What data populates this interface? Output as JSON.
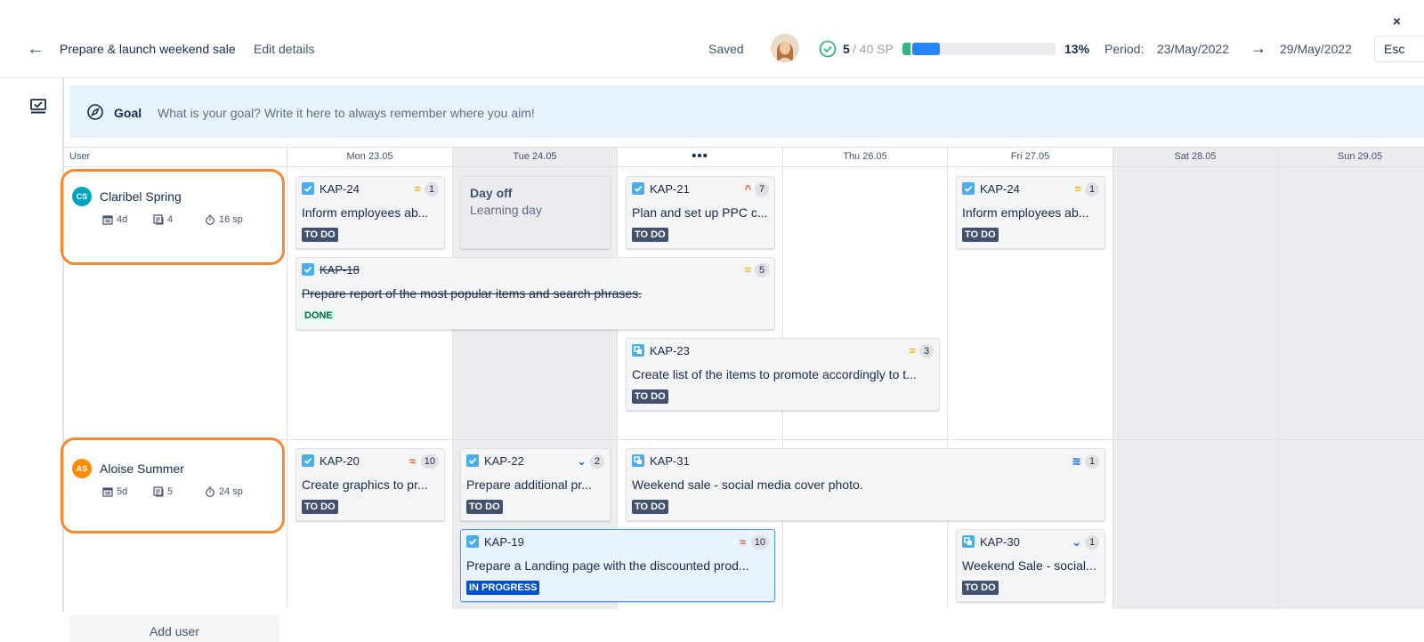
{
  "header": {
    "close_label": "×",
    "title": "Prepare & launch weekend sale",
    "edit_details": "Edit details",
    "saved": "Saved",
    "sp_done": "5",
    "sp_total": "/ 40 SP",
    "progress": {
      "done_fraction": 0.05,
      "inprogress_fraction": 0.08
    },
    "percent": "13%",
    "period_label": "Period:",
    "period_start": "23/May/2022",
    "period_end": "29/May/2022",
    "esc_label": "Esc"
  },
  "goal": {
    "label": "Goal",
    "placeholder": "What is your goal? Write it here to always remember where you aim!"
  },
  "grid": {
    "user_col": "User",
    "days": [
      "Mon 23.05",
      "Tue 24.05",
      "",
      "Thu 26.05",
      "Fri 27.05",
      "Sat 28.05",
      "Sun 29.05"
    ],
    "hidden_day_label": "•••"
  },
  "users": [
    {
      "initials": "CS",
      "name": "Claribel Spring",
      "days": "4d",
      "issues": "4",
      "sp": "16 sp",
      "color": "#00a3bf"
    },
    {
      "initials": "AS",
      "name": "Aloise Summer",
      "days": "5d",
      "issues": "5",
      "sp": "24 sp",
      "color": "#ff8b00"
    }
  ],
  "dayoff": {
    "title": "Day off",
    "subtitle": "Learning day"
  },
  "cards": [
    {
      "key": "KAP-24",
      "summary": "Inform employees ab...",
      "status": "TO DO",
      "sp": "1",
      "priority": "medium",
      "type": "task"
    },
    {
      "key": "KAP-21",
      "summary": "Plan and set up PPC c...",
      "status": "TO DO",
      "sp": "7",
      "priority": "high",
      "type": "task"
    },
    {
      "key": "KAP-24",
      "summary": "Inform employees ab...",
      "status": "TO DO",
      "sp": "1",
      "priority": "medium",
      "type": "task"
    },
    {
      "key": "KAP-18",
      "summary": "Prepare report of the most popular items and search phrases.",
      "status": "DONE",
      "sp": "5",
      "priority": "medium",
      "type": "task"
    },
    {
      "key": "KAP-23",
      "summary": "Create list of the items to promote accordingly to t...",
      "status": "TO DO",
      "sp": "3",
      "priority": "medium",
      "type": "story"
    },
    {
      "key": "KAP-20",
      "summary": "Create graphics to pr...",
      "status": "TO DO",
      "sp": "10",
      "priority": "highest",
      "type": "task"
    },
    {
      "key": "KAP-22",
      "summary": "Prepare additional pr...",
      "status": "TO DO",
      "sp": "2",
      "priority": "low",
      "type": "task"
    },
    {
      "key": "KAP-31",
      "summary": "Weekend sale - social media cover photo.",
      "status": "TO DO",
      "sp": "1",
      "priority": "lowest",
      "type": "story"
    },
    {
      "key": "KAP-19",
      "summary": "Prepare a Landing page with the discounted prod...",
      "status": "IN PROGRESS",
      "sp": "10",
      "priority": "highest",
      "type": "task"
    },
    {
      "key": "KAP-30",
      "summary": "Weekend Sale - social...",
      "status": "TO DO",
      "sp": "1",
      "priority": "low",
      "type": "story"
    }
  ],
  "add_user": "Add user",
  "colors": {
    "user_highlight": "#f7882f",
    "goal_bg": "#e6f5fd",
    "priority_medium": "#ffab00",
    "priority_high": "#ff5630",
    "priority_low": "#0065ff",
    "task_icon": "#4bade8",
    "story_icon": "#4bade8"
  }
}
